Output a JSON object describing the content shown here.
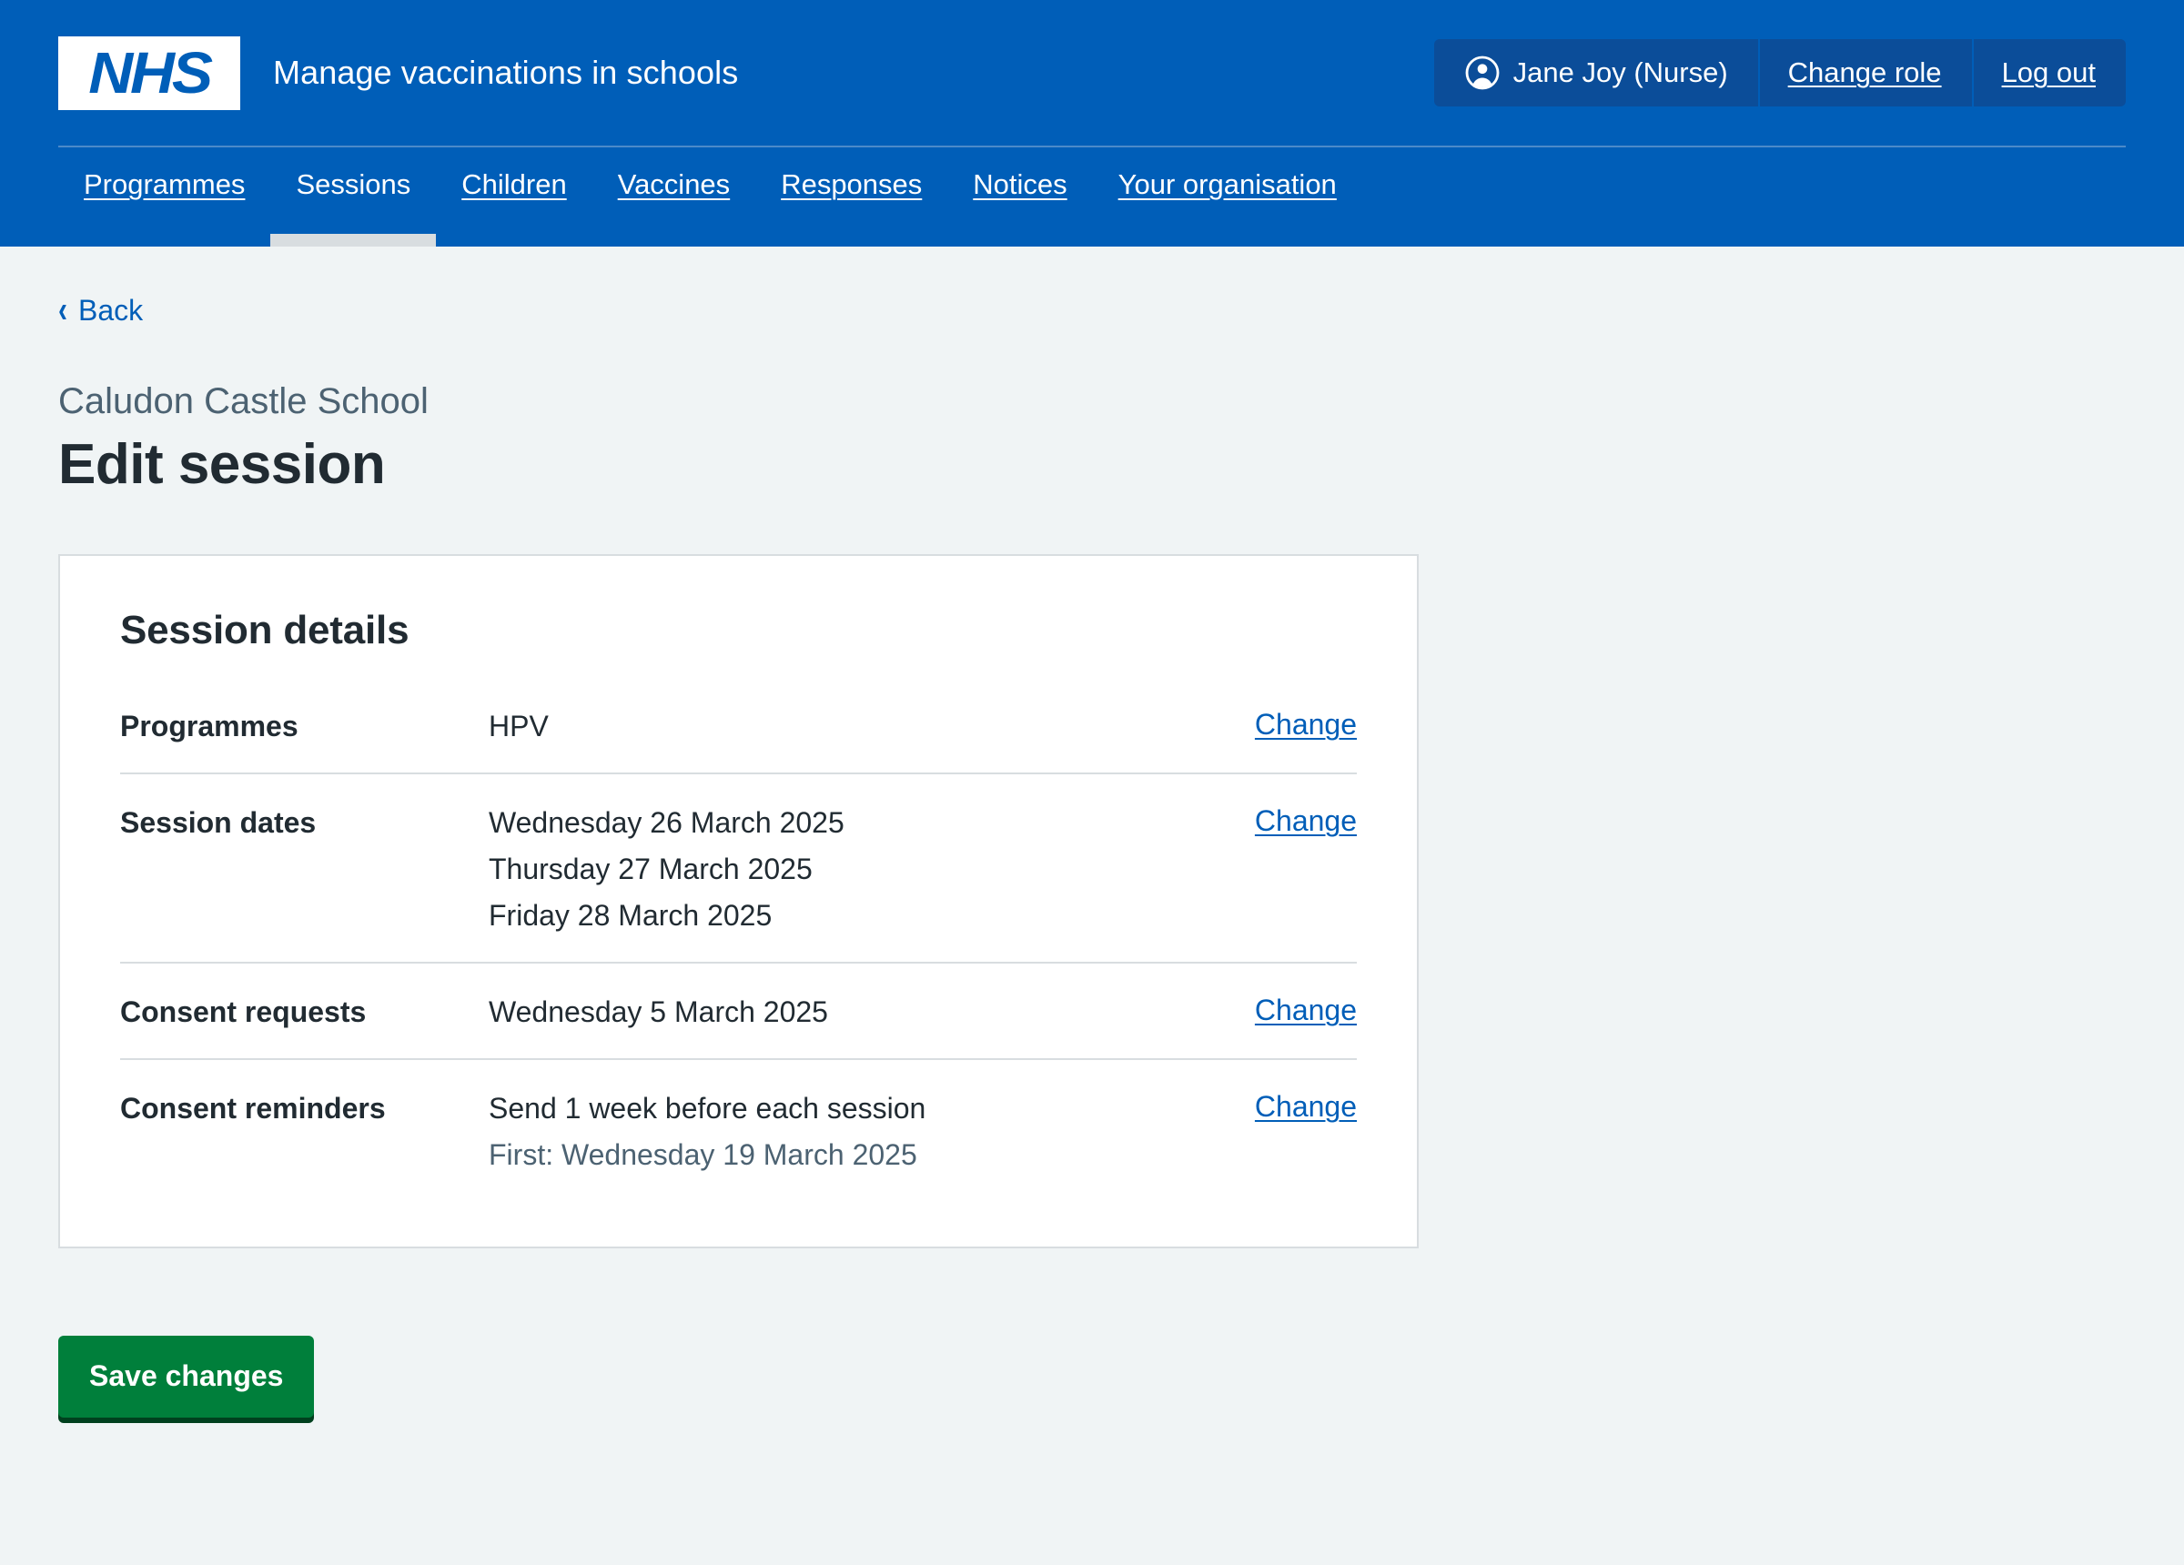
{
  "header": {
    "logo_text": "NHS",
    "service_name": "Manage vaccinations in schools",
    "account": {
      "user": "Jane Joy (Nurse)",
      "change_role": "Change role",
      "log_out": "Log out",
      "avatar_icon": "account-circle-icon"
    }
  },
  "nav": {
    "items": [
      {
        "label": "Programmes",
        "active": false
      },
      {
        "label": "Sessions",
        "active": true
      },
      {
        "label": "Children",
        "active": false
      },
      {
        "label": "Vaccines",
        "active": false
      },
      {
        "label": "Responses",
        "active": false
      },
      {
        "label": "Notices",
        "active": false
      },
      {
        "label": "Your organisation",
        "active": false
      }
    ]
  },
  "back": {
    "label": "Back",
    "icon": "chevron-left-icon"
  },
  "page": {
    "caption": "Caludon Castle School",
    "title": "Edit session"
  },
  "card": {
    "title": "Session details",
    "rows": [
      {
        "key": "Programmes",
        "values": [
          "HPV"
        ],
        "sub": "",
        "action": "Change"
      },
      {
        "key": "Session dates",
        "values": [
          "Wednesday 26 March 2025",
          "Thursday 27 March 2025",
          "Friday 28 March 2025"
        ],
        "sub": "",
        "action": "Change"
      },
      {
        "key": "Consent requests",
        "values": [
          "Wednesday 5 March 2025"
        ],
        "sub": "",
        "action": "Change"
      },
      {
        "key": "Consent reminders",
        "values": [
          "Send 1 week before each session"
        ],
        "sub": "First: Wednesday 19 March 2025",
        "action": "Change"
      }
    ]
  },
  "actions": {
    "save_label": "Save changes"
  },
  "colors": {
    "nhs_blue": "#005eb8",
    "nhs_dark_blue": "#0b4d99",
    "page_bg": "#f0f4f5",
    "text": "#212b32",
    "secondary_text": "#4c6272",
    "link": "#005eb8",
    "border": "#d8dde0",
    "green": "#007f3b",
    "green_shadow": "#00401e"
  }
}
